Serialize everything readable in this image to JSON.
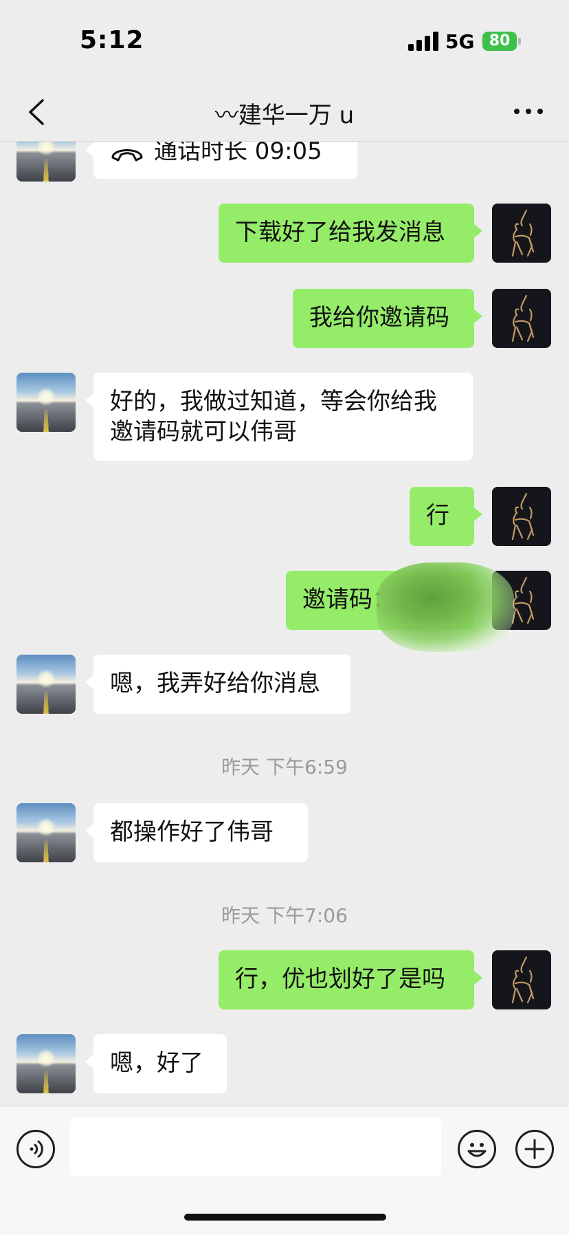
{
  "status_bar": {
    "time": "5:12",
    "network": "5G",
    "battery": "80"
  },
  "nav": {
    "title": "〰建华一万 u"
  },
  "messages": [
    {
      "side": "left",
      "text": "通话时长 09:05",
      "icon": "phone-icon"
    },
    {
      "side": "right",
      "text": "下载好了给我发消息"
    },
    {
      "side": "right",
      "text": "我给你邀请码"
    },
    {
      "side": "left",
      "text": "好的，我做过知道，等会你给我邀请码就可以伟哥"
    },
    {
      "side": "right",
      "text": "行"
    },
    {
      "side": "right",
      "text": "邀请码："
    },
    {
      "side": "left",
      "text": "嗯，我弄好给你消息"
    },
    {
      "side": "left",
      "text": "都操作好了伟哥"
    },
    {
      "side": "right",
      "text": "行，优也划好了是吗"
    },
    {
      "side": "left",
      "text": "嗯，好了"
    }
  ],
  "timestamps": [
    "昨天 下午6:59",
    "昨天 下午7:06"
  ],
  "input_bar": {
    "placeholder": ""
  },
  "colors": {
    "sent_bubble": "#95ec69",
    "received_bubble": "#ffffff",
    "background": "#ededed"
  }
}
